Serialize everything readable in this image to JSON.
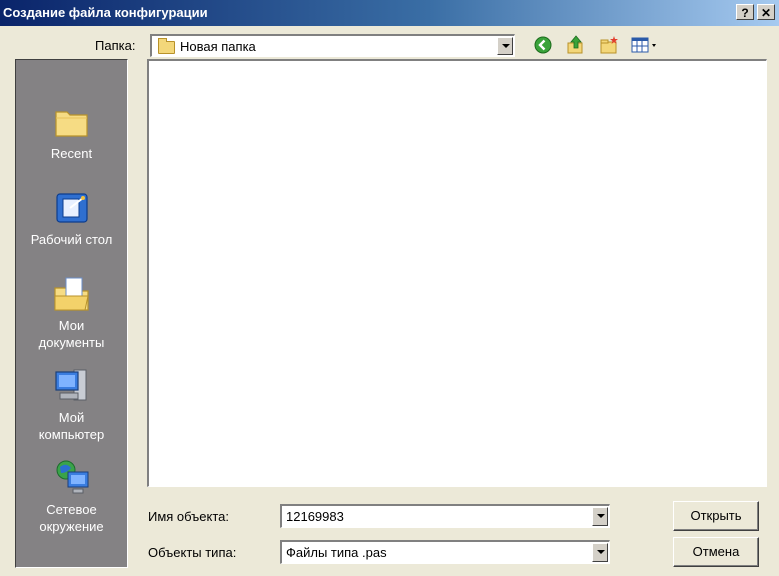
{
  "window": {
    "title": "Создание файла конфигурации",
    "help_label": "?",
    "close_label": "✕"
  },
  "toolbar": {
    "folder_label": "Папка:",
    "folder_value": "Новая папка",
    "icons": [
      "back-icon",
      "up-folder-icon",
      "new-folder-icon",
      "view-menu-icon"
    ]
  },
  "places": [
    {
      "label": "Recent",
      "icon": "recent-folder-icon"
    },
    {
      "label": "Рабочий стол",
      "icon": "desktop-icon"
    },
    {
      "label": "Мои документы",
      "icon": "my-documents-icon"
    },
    {
      "label": "Мой компьютер",
      "icon": "my-computer-icon"
    },
    {
      "label": "Сетевое окружение",
      "icon": "network-icon"
    }
  ],
  "form": {
    "filename_label": "Имя объекта:",
    "filename_value": "12169983",
    "filetype_label": "Объекты типа:",
    "filetype_value": "Файлы типа .pas"
  },
  "buttons": {
    "open_label": "Открыть",
    "cancel_label": "Отмена"
  },
  "colors": {
    "title_bar_start": "#0a246a",
    "title_bar_end": "#a6caf0",
    "places_bar": "#848284",
    "dialog_bg": "#ece9d8"
  }
}
